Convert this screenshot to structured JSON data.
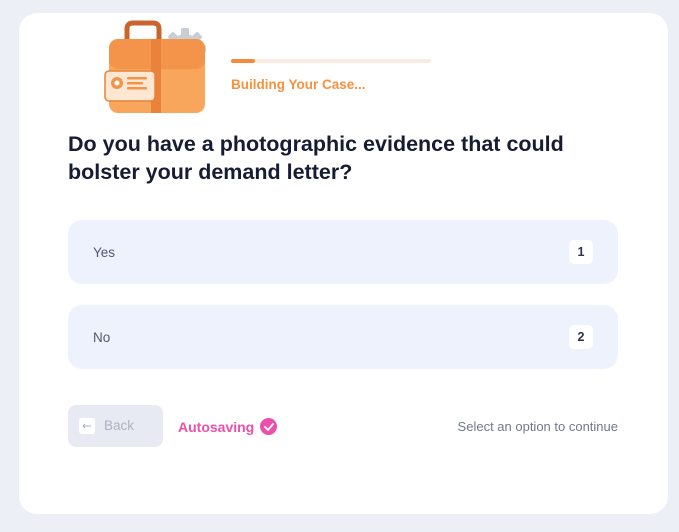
{
  "progress": {
    "label": "Building Your Case...",
    "percent": 12
  },
  "question": {
    "text": "Do you have a photographic evidence that could bolster your demand letter?"
  },
  "options": [
    {
      "label": "Yes",
      "key": "1"
    },
    {
      "label": "No",
      "key": "2"
    }
  ],
  "footer": {
    "back_label": "Back",
    "autosave_label": "Autosaving",
    "hint": "Select an option to continue"
  },
  "icons": {
    "illustration": "briefcase-gear-icon",
    "back": "arrow-left-icon",
    "autosave": "check-circle-icon"
  },
  "colors": {
    "accent_orange": "#f58a3c",
    "autosave_pink": "#ec4faa",
    "option_bg": "#eef2fd",
    "question_text": "#161c33"
  }
}
